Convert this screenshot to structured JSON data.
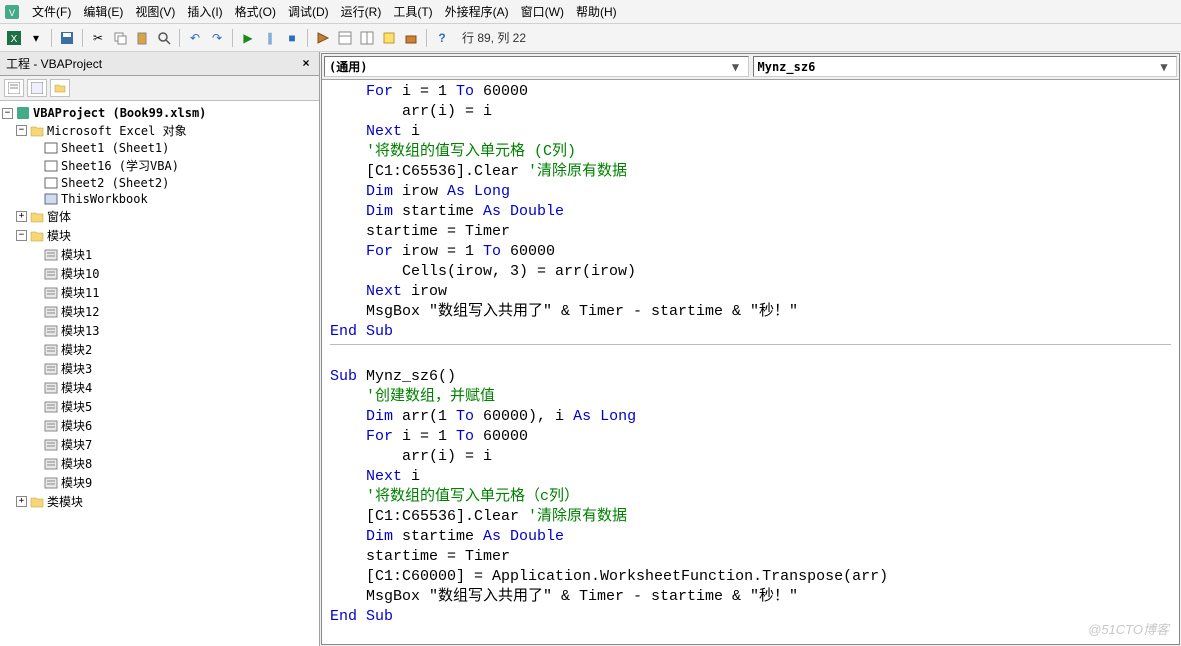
{
  "menu": {
    "file": "文件(F)",
    "edit": "编辑(E)",
    "view": "视图(V)",
    "insert": "插入(I)",
    "format": "格式(O)",
    "debug": "调试(D)",
    "run": "运行(R)",
    "tools": "工具(T)",
    "addins": "外接程序(A)",
    "window": "窗口(W)",
    "help": "帮助(H)"
  },
  "toolbar": {
    "status": "行 89, 列 22"
  },
  "project_panel": {
    "title": "工程 - VBAProject",
    "close": "×"
  },
  "tree": {
    "root": "VBAProject (Book99.xlsm)",
    "excel_objects": "Microsoft Excel 对象",
    "sheet1": "Sheet1 (Sheet1)",
    "sheet16": "Sheet16 (学习VBA)",
    "sheet2": "Sheet2 (Sheet2)",
    "thiswb": "ThisWorkbook",
    "forms": "窗体",
    "modules": "模块",
    "mod1": "模块1",
    "mod10": "模块10",
    "mod11": "模块11",
    "mod12": "模块12",
    "mod13": "模块13",
    "mod2": "模块2",
    "mod3": "模块3",
    "mod4": "模块4",
    "mod5": "模块5",
    "mod6": "模块6",
    "mod7": "模块7",
    "mod8": "模块8",
    "mod9": "模块9",
    "class_modules": "类模块"
  },
  "code_header": {
    "object": "(通用)",
    "proc": "Mynz_sz6"
  },
  "code": {
    "l1a": "    For",
    "l1b": " i = 1 ",
    "l1c": "To",
    "l1d": " 60000",
    "l2": "        arr(i) = i",
    "l3a": "    Next",
    "l3b": " i",
    "l4": "    '将数组的值写入单元格 (C列)",
    "l5a": "    [C1:C65536].Clear ",
    "l5b": "'清除原有数据",
    "l6a": "    Dim",
    "l6b": " irow ",
    "l6c": "As Long",
    "l7a": "    Dim",
    "l7b": " startime ",
    "l7c": "As Double",
    "l8": "    startime = Timer",
    "l9a": "    For",
    "l9b": " irow = 1 ",
    "l9c": "To",
    "l9d": " 60000",
    "l10": "        Cells(irow, 3) = arr(irow)",
    "l11a": "    Next",
    "l11b": " irow",
    "l12": "    MsgBox \"数组写入共用了\" & Timer - startime & \"秒！\"",
    "l13": "End Sub",
    "l14": "",
    "l15a": "Sub",
    "l15b": " Mynz_sz6()",
    "l16": "    '创建数组，并赋值",
    "l17a": "    Dim",
    "l17b": " arr(1 ",
    "l17c": "To",
    "l17d": " 60000), i ",
    "l17e": "As Long",
    "l18a": "    For",
    "l18b": " i = 1 ",
    "l18c": "To",
    "l18d": " 60000",
    "l19": "        arr(i) = i",
    "l20a": "    Next",
    "l20b": " i",
    "l21": "    '将数组的值写入单元格（c列）",
    "l22a": "    [C1:C65536].Clear ",
    "l22b": "'清除原有数据",
    "l23a": "    Dim",
    "l23b": " startime ",
    "l23c": "As Double",
    "l24": "    startime = Timer",
    "l25": "    [C1:C60000] = Application.WorksheetFunction.Transpose(arr)",
    "l26": "    MsgBox \"数组写入共用了\" & Timer - startime & \"秒！\"",
    "l27": "End Sub"
  },
  "watermark": "@51CTO博客"
}
